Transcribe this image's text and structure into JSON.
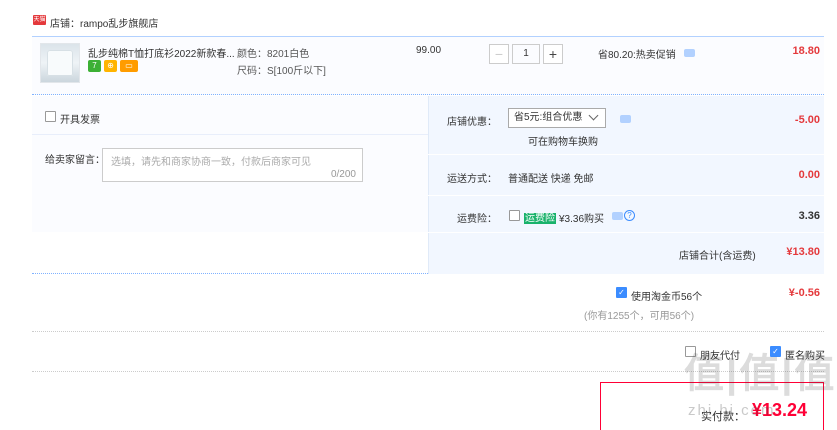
{
  "shop": {
    "badge": "天猫",
    "name": "店铺：rampo乱步旗舰店"
  },
  "item": {
    "title": "乱步纯棉T恤打底衫2022新款春...",
    "services": [
      "7",
      "⊕",
      "▭"
    ],
    "sku_color": "颜色：8201白色",
    "sku_size": "尺码：S[100斤以下]",
    "price": "99.00",
    "quantity": "1",
    "qty_minus": "−",
    "qty_plus": "+",
    "promo": "省80.20:热卖促销",
    "total": "18.80"
  },
  "invoice": {
    "label": "开具发票"
  },
  "message": {
    "label": "给卖家留言：",
    "placeholder": "选填，请先和商家协商一致，付款后商家可见",
    "count": "0/200"
  },
  "shop_discount": {
    "label": "店铺优惠：",
    "selected": "省5元:组合优惠",
    "note": "可在购物车换购",
    "value": "-5.00"
  },
  "shipping": {
    "label": "运送方式：",
    "method": "普通配送 快递 免邮",
    "value": "0.00"
  },
  "insurance": {
    "label": "运费险：",
    "name": "运费险",
    "desc": "¥3.36购买",
    "help": "?",
    "value": "3.36"
  },
  "shop_total": {
    "label": "店铺合计(含运费)",
    "value": "¥13.80"
  },
  "coins": {
    "label": "使用淘金币56个",
    "note": "(你有1255个，可用56个)",
    "value": "¥-0.56"
  },
  "options": {
    "pay_for_me": "朋友代付",
    "anonymous": "匿名购买"
  },
  "payment": {
    "label": "实付款：",
    "value": "¥13.24"
  },
  "watermark": {
    "main": "值|值|值",
    "sub": "zhi.hi.com"
  },
  "colors": {
    "accent_red": "#e4393c",
    "accent_blue": "#3b8cff",
    "highlight_green": "#19b26b"
  }
}
